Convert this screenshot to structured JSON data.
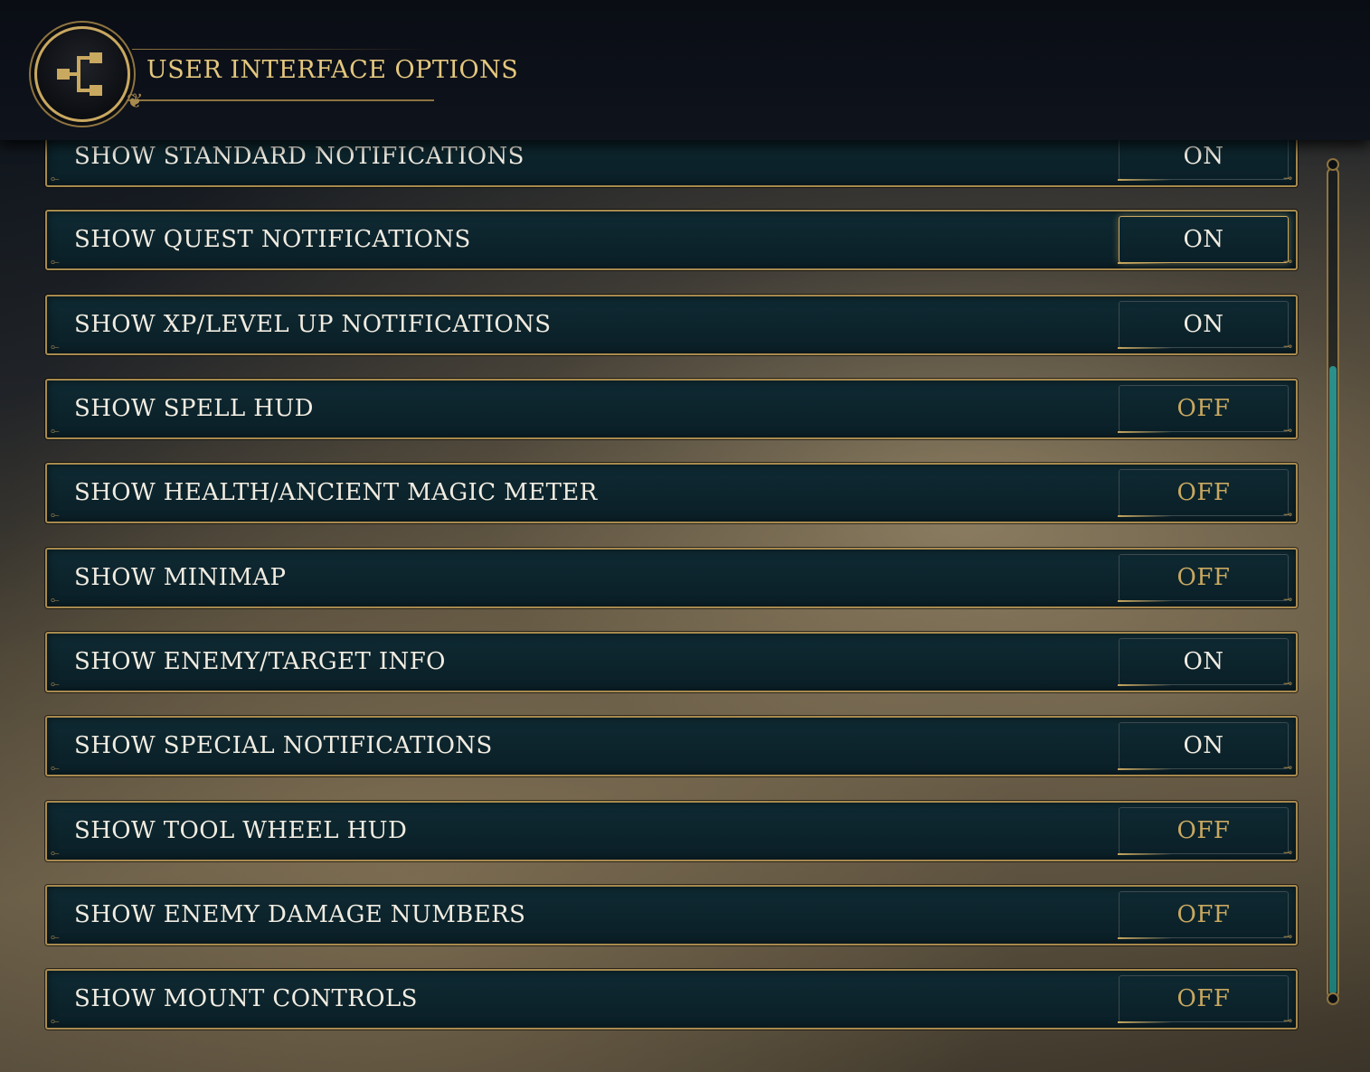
{
  "header": {
    "title": "USER INTERFACE OPTIONS",
    "icon": "tree-branch-icon"
  },
  "options": [
    {
      "label": "SHOW STANDARD NOTIFICATIONS",
      "value": "ON"
    },
    {
      "label": "SHOW QUEST NOTIFICATIONS",
      "value": "ON"
    },
    {
      "label": "SHOW XP/LEVEL UP NOTIFICATIONS",
      "value": "ON"
    },
    {
      "label": "SHOW SPELL HUD",
      "value": "OFF"
    },
    {
      "label": "SHOW HEALTH/ANCIENT MAGIC METER",
      "value": "OFF"
    },
    {
      "label": "SHOW MINIMAP",
      "value": "OFF"
    },
    {
      "label": "SHOW ENEMY/TARGET INFO",
      "value": "ON"
    },
    {
      "label": "SHOW SPECIAL NOTIFICATIONS",
      "value": "ON"
    },
    {
      "label": "SHOW TOOL WHEEL HUD",
      "value": "OFF"
    },
    {
      "label": "SHOW ENEMY DAMAGE NUMBERS",
      "value": "OFF"
    },
    {
      "label": "SHOW MOUNT CONTROLS",
      "value": "OFF"
    }
  ],
  "colors": {
    "accent_gold": "#c9a860",
    "row_bg": "#0f2a33",
    "on_text": "#f1ece1",
    "off_text": "#c9a860",
    "scroll_thumb": "#2b8f8a"
  }
}
